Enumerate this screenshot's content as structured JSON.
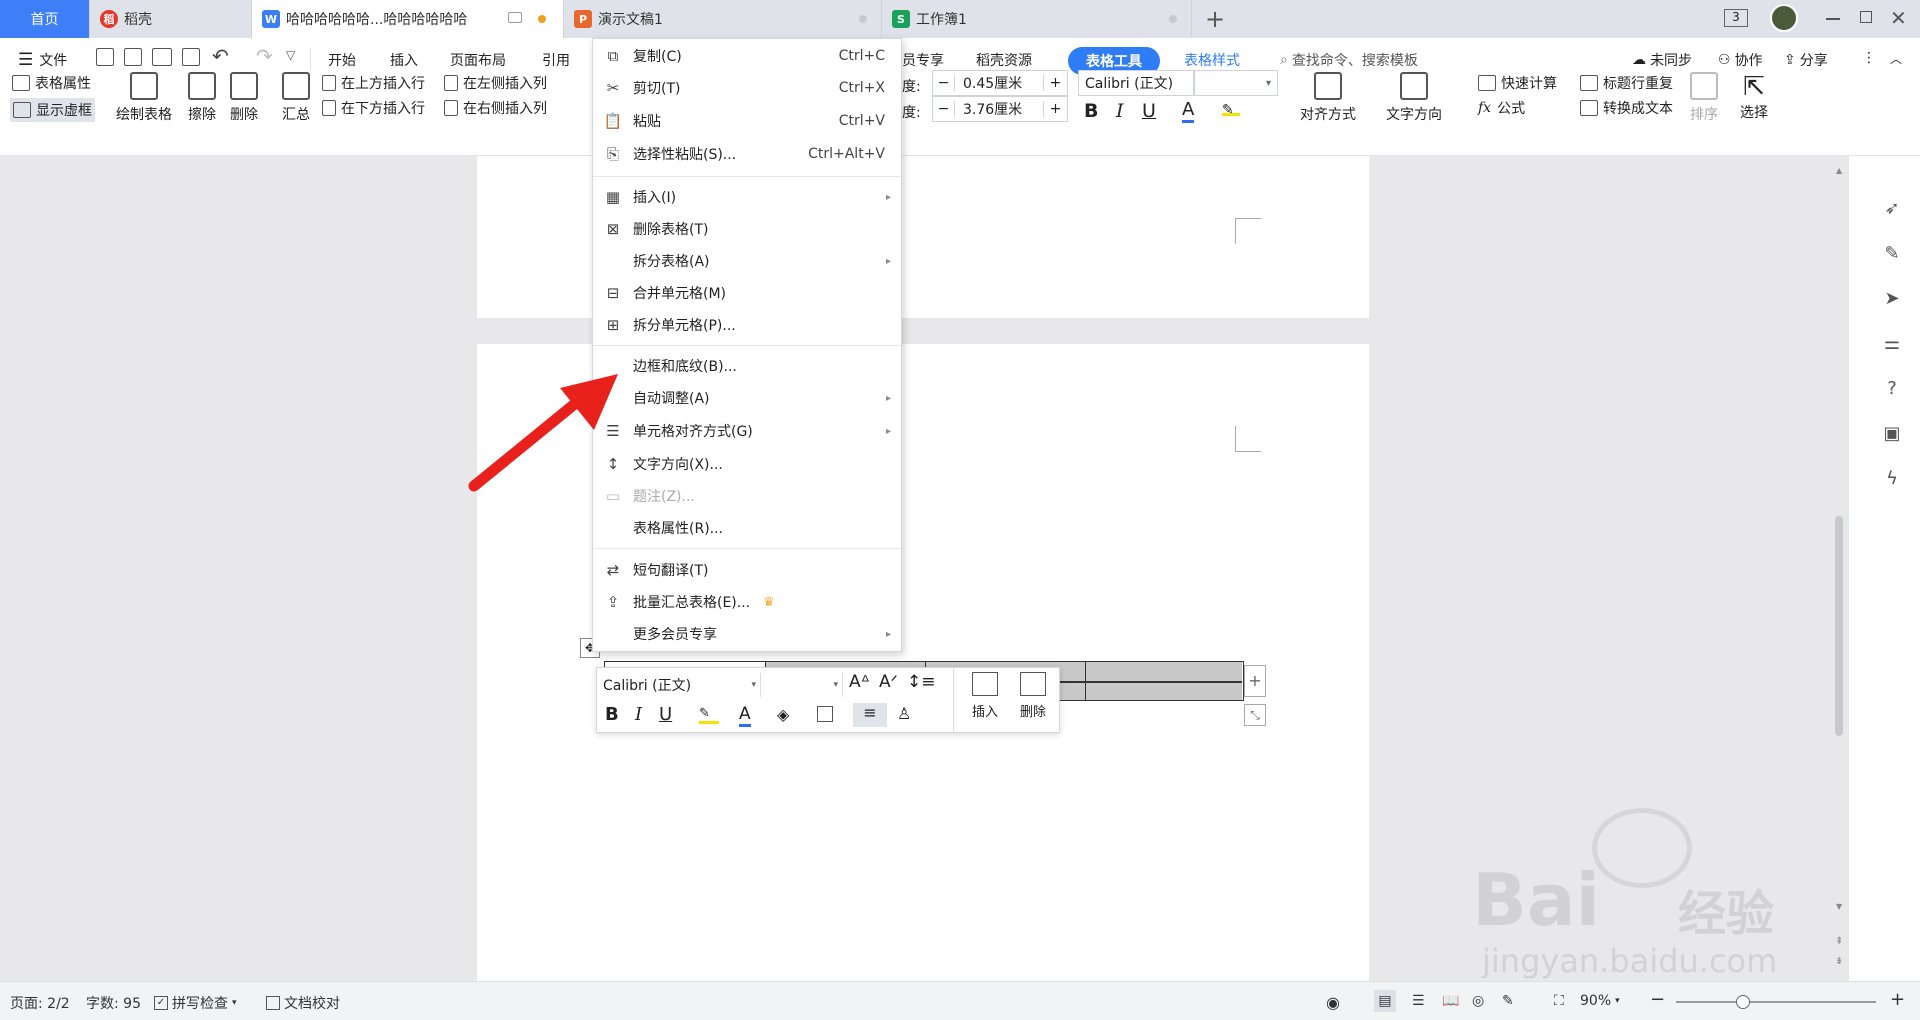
{
  "tabs": {
    "home": "首页",
    "daoke": "稻壳",
    "doc": "哈哈哈哈哈哈...哈哈哈哈哈哈",
    "ppt": "演示文稿1",
    "sheet": "工作簿1",
    "add": "+",
    "badge": "3"
  },
  "menubar": {
    "file": "文件",
    "items": [
      "开始",
      "插入",
      "页面布局",
      "引用"
    ],
    "right": [
      "员专享",
      "稻壳资源"
    ],
    "active_tab": "表格工具",
    "style_tab": "表格样式",
    "search": "查找命令、搜索模板",
    "sync": "未同步",
    "collab": "协作",
    "share": "分享"
  },
  "ribbon": {
    "table_props": "表格属性",
    "show_grid": "显示虚框",
    "draw_table": "绘制表格",
    "erase": "擦除",
    "delete": "删除",
    "summary": "汇总",
    "insert_above": "在上方插入行",
    "insert_below": "在下方插入行",
    "insert_left": "在左侧插入列",
    "insert_right": "在右侧插入列",
    "height_label": "度:",
    "width_label": "度:",
    "height_value": "0.45厘米",
    "width_value": "3.76厘米",
    "font_name": "Calibri (正文)",
    "align": "对齐方式",
    "text_dir": "文字方向",
    "quick_calc": "快速计算",
    "formula": "公式",
    "title_repeat": "标题行重复",
    "to_text": "转换成文本",
    "sort": "排序",
    "select": "选择"
  },
  "context_menu": [
    {
      "label": "复制(C)",
      "shortcut": "Ctrl+C",
      "icon": "copy-icon"
    },
    {
      "label": "剪切(T)",
      "shortcut": "Ctrl+X",
      "icon": "scissors-icon"
    },
    {
      "label": "粘贴",
      "shortcut": "Ctrl+V",
      "icon": "paste-icon"
    },
    {
      "label": "选择性粘贴(S)...",
      "shortcut": "Ctrl+Alt+V",
      "icon": "paste-special-icon"
    },
    {
      "label": "插入(I)",
      "icon": "table-insert-icon"
    },
    {
      "label": "删除表格(T)",
      "icon": "table-delete-icon"
    },
    {
      "label": "拆分表格(A)"
    },
    {
      "label": "合并单元格(M)",
      "icon": "merge-cells-icon"
    },
    {
      "label": "拆分单元格(P)...",
      "icon": "split-cells-icon"
    },
    {
      "label": "边框和底纹(B)..."
    },
    {
      "label": "自动调整(A)"
    },
    {
      "label": "单元格对齐方式(G)",
      "icon": "cell-align-icon"
    },
    {
      "label": "文字方向(X)...",
      "icon": "text-direction-icon"
    },
    {
      "label": "题注(Z)...",
      "icon": "caption-icon"
    },
    {
      "label": "表格属性(R)..."
    },
    {
      "label": "短句翻译(T)",
      "icon": "translate-icon"
    },
    {
      "label": "批量汇总表格(E)...",
      "icon": "batch-summary-icon"
    },
    {
      "label": "更多会员专享"
    }
  ],
  "mini_toolbar": {
    "font": "Calibri (正文)",
    "insert": "插入",
    "delete": "删除"
  },
  "status": {
    "page": "页面: 2/2",
    "words": "字数: 95",
    "spell": "拼写检查",
    "proof": "文档校对",
    "zoom": "90%"
  },
  "watermark": {
    "brand": "Bai",
    "brand2": "经验",
    "url": "jingyan.baidu.com"
  },
  "colors": {
    "accent": "#2e7cf6",
    "arrow": "#e8211c",
    "crown": "#f5a623"
  }
}
